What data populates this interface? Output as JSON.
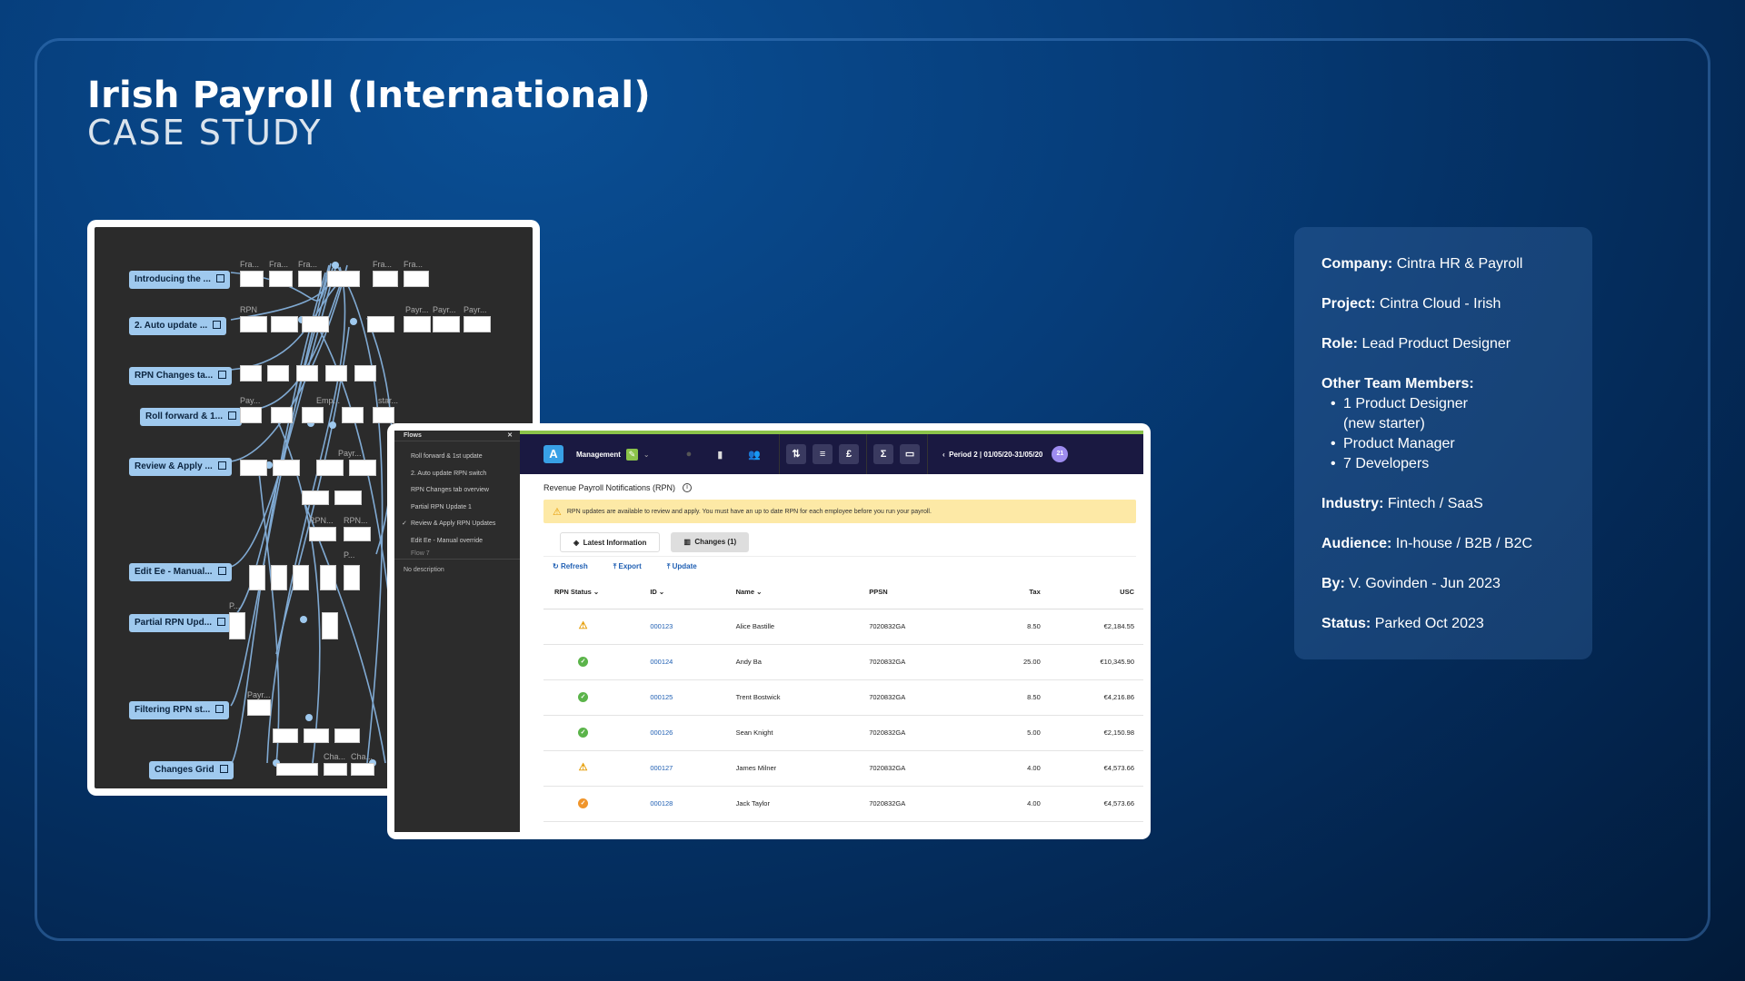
{
  "slide": {
    "title": "Irish Payroll (International)",
    "subtitle": "CASE  STUDY"
  },
  "info": {
    "company_label": "Company:",
    "company": "Cintra HR & Payroll",
    "project_label": "Project:",
    "project": "Cintra Cloud - Irish",
    "role_label": "Role:",
    "role": "Lead Product Designer",
    "team_label": "Other Team Members:",
    "team": [
      "1 Product Designer",
      "(new starter)",
      "Product Manager",
      "7 Developers"
    ],
    "industry_label": "Industry:",
    "industry": "Fintech / SaaS",
    "audience_label": "Audience:",
    "audience": "In-house / B2B / B2C",
    "by_label": "By:",
    "by": "V. Govinden - Jun 2023",
    "status_label": "Status:",
    "status": "Parked Oct 2023"
  },
  "flow_diagram": {
    "labels": [
      "Introducing the ...",
      "2. Auto update ...",
      "RPN Changes ta...",
      "Roll forward & 1...",
      "Review & Apply ...",
      "Edit Ee - Manual...",
      "Partial RPN Upd...",
      "Filtering RPN st...",
      "Changes Grid"
    ],
    "tags": [
      "Fra...",
      "Fra...",
      "Fra...",
      "Fra...",
      "Fra...",
      "RPN",
      "Payr...",
      "Payr...",
      "Payr...",
      "Pay...",
      "Emp...",
      "star...",
      "Payr...",
      "RPN...",
      "RPN...",
      "P...",
      "P...",
      "Payr...",
      "Cha...",
      "Cha..."
    ]
  },
  "flows_panel": {
    "header": "Flows",
    "items": [
      "Roll forward & 1st update",
      "2. Auto update RPN switch",
      "RPN Changes tab overview",
      "Partial RPN Update 1",
      "Review & Apply RPN Updates",
      "Edit Ee - Manual override",
      "Flow 7"
    ],
    "active_item": "Review & Apply RPN Updates",
    "description": "No description"
  },
  "app": {
    "workspace": "Management",
    "period": "Period 2 | 01/05/20-31/05/20",
    "period_badge": "21",
    "page_title": "Revenue Payroll Notifications (RPN)",
    "alert": "RPN updates are available to review and apply. You must have an up to date RPN for each employee before you run your payroll.",
    "tabs": [
      "Latest Information",
      "Changes (1)"
    ],
    "actions": [
      "Refresh",
      "Export",
      "Update"
    ],
    "columns": [
      "RPN Status",
      "ID",
      "Name",
      "PPSN",
      "Tax",
      "USC"
    ],
    "rows": [
      {
        "status": "warning",
        "id": "000123",
        "name": "Alice Bastille",
        "ppsn": "7020832GA",
        "tax": "8.50",
        "usc": "€2,184.55"
      },
      {
        "status": "ok",
        "id": "000124",
        "name": "Andy Ba",
        "ppsn": "7020832GA",
        "tax": "25.00",
        "usc": "€10,345.90"
      },
      {
        "status": "ok",
        "id": "000125",
        "name": "Trent Bostwick",
        "ppsn": "7020832GA",
        "tax": "8.50",
        "usc": "€4,216.86"
      },
      {
        "status": "ok",
        "id": "000126",
        "name": "Sean Knight",
        "ppsn": "7020832GA",
        "tax": "5.00",
        "usc": "€2,150.98"
      },
      {
        "status": "warning",
        "id": "000127",
        "name": "James Milner",
        "ppsn": "7020832GA",
        "tax": "4.00",
        "usc": "€4,573.66"
      },
      {
        "status": "pending",
        "id": "000128",
        "name": "Jack Taylor",
        "ppsn": "7020832GA",
        "tax": "4.00",
        "usc": "€4,573.66"
      }
    ]
  },
  "colors": {
    "accent_blue": "#1f5fb3",
    "topbar": "#1a1941",
    "label_blue": "#9fc9ee",
    "alert_bg": "#fde9a6"
  }
}
